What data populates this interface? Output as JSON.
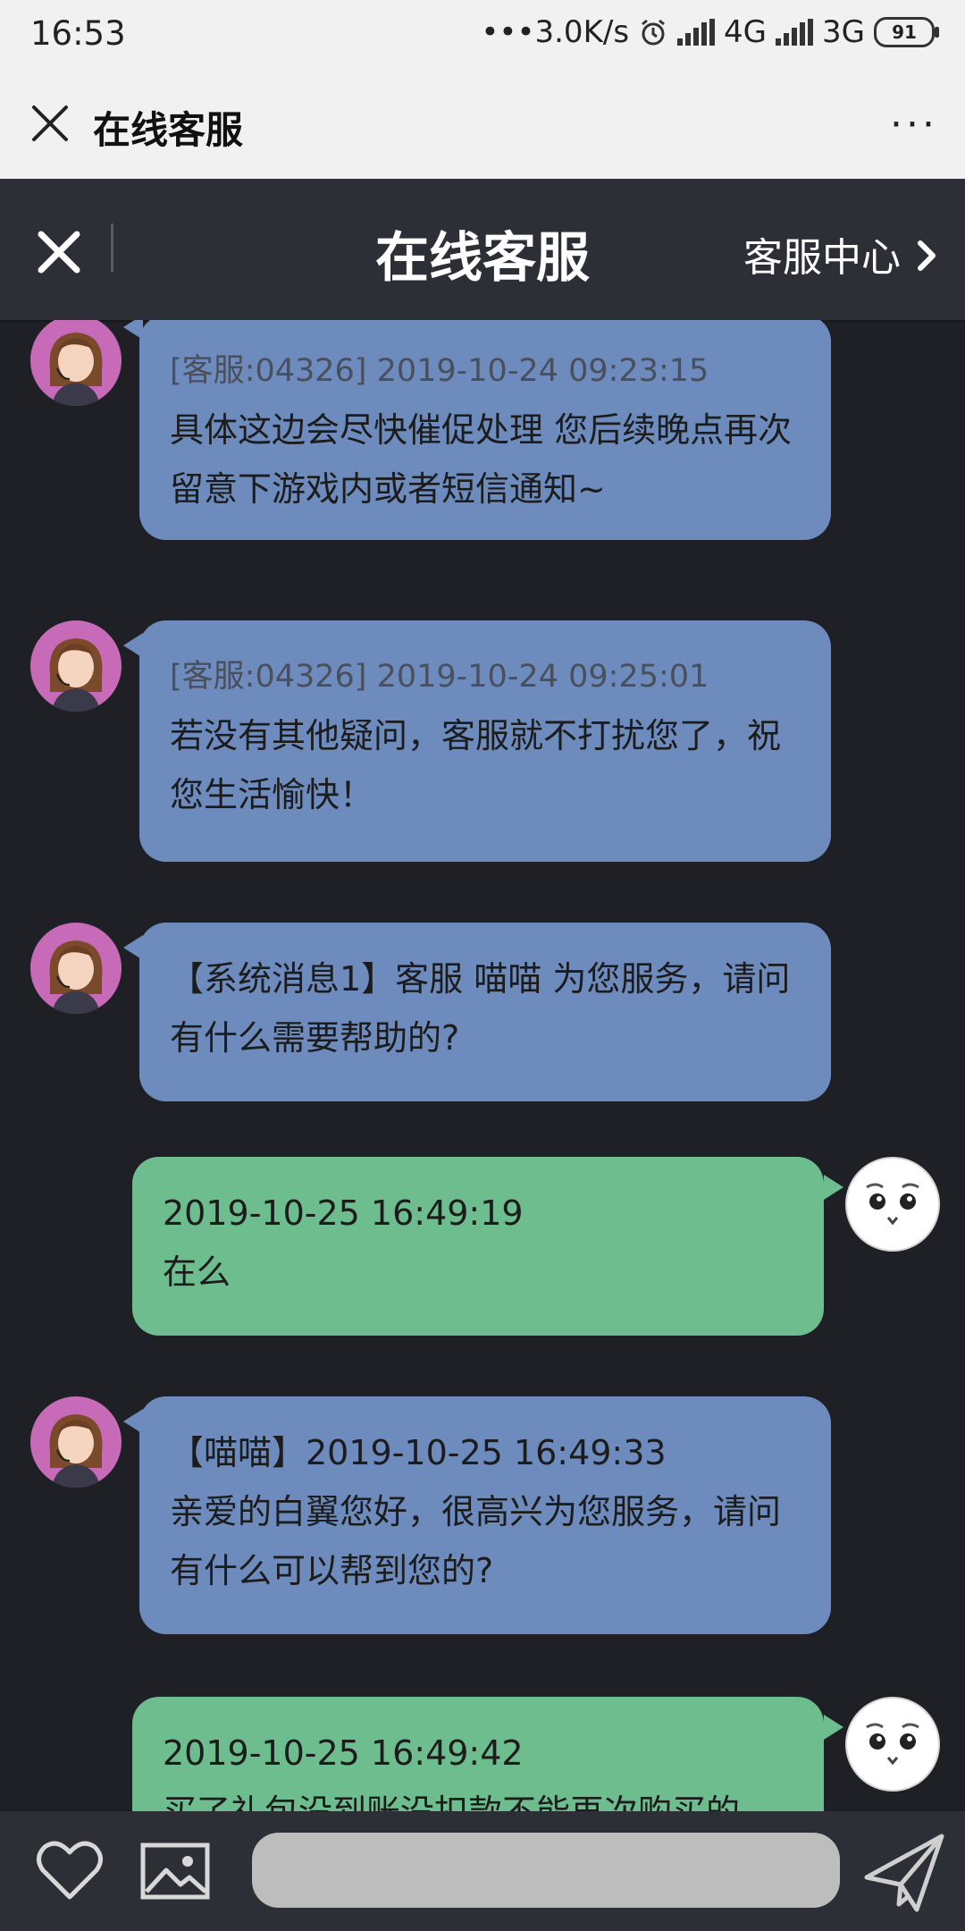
{
  "status_bar": {
    "time": "16:53",
    "network_speed": "•••3.0K/s",
    "net1": "4G",
    "net2": "3G",
    "battery": "91"
  },
  "web_titlebar": {
    "title": "在线客服",
    "more": "···"
  },
  "header": {
    "title": "在线客服",
    "link_label": "客服中心"
  },
  "messages": [
    {
      "from": "agent",
      "meta": "[客服:04326] 2019-10-24 09:23:15",
      "text": "具体这边会尽快催促处理 您后续晚点再次留意下游戏内或者短信通知~"
    },
    {
      "from": "agent",
      "meta": "[客服:04326] 2019-10-24 09:25:01",
      "text": "若没有其他疑问，客服就不打扰您了，祝您生活愉快！"
    },
    {
      "from": "agent",
      "meta": "",
      "text": "【系统消息1】客服 喵喵 为您服务，请问有什么需要帮助的?"
    },
    {
      "from": "user",
      "meta": "2019-10-25 16:49:19",
      "text": "在么"
    },
    {
      "from": "agent",
      "meta": "【喵喵】2019-10-25 16:49:33",
      "text": "亲爱的白翼您好，很高兴为您服务，请问有什么可以帮到您的?"
    },
    {
      "from": "user",
      "meta": "2019-10-25 16:49:42",
      "text": "买了礼包没到账没扣款不能再次购买的"
    }
  ],
  "input": {
    "placeholder": ""
  },
  "icons": {
    "close": "close-icon",
    "more": "more-icon",
    "chevron": "chevron-right-icon",
    "heart": "heart-icon",
    "image": "image-icon",
    "send": "send-icon"
  },
  "colors": {
    "agent_bubble": "#6d8bbd",
    "user_bubble": "#6ebd8f",
    "background": "#1f2026",
    "header": "#2d2f36"
  }
}
